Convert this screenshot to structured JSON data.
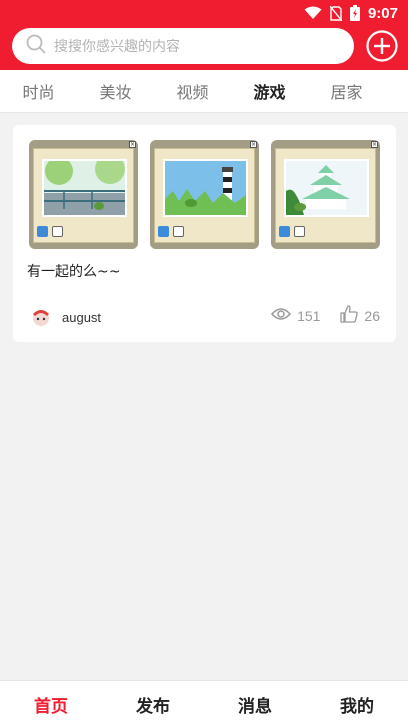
{
  "status_bar": {
    "time": "9:07",
    "icons": [
      "wifi-icon",
      "no-sim-icon",
      "battery-charging-icon"
    ]
  },
  "search": {
    "placeholder": "搜搜你感兴趣的内容",
    "icon": "search-icon"
  },
  "header": {
    "add_icon": "plus-circle-icon"
  },
  "tabs": [
    {
      "label": "时尚",
      "active": false
    },
    {
      "label": "美妆",
      "active": false
    },
    {
      "label": "视频",
      "active": false
    },
    {
      "label": "游戏",
      "active": true
    },
    {
      "label": "居家",
      "active": false
    }
  ],
  "post": {
    "images": [
      "frog-on-railing-thumbnail",
      "frog-lighthouse-thumbnail",
      "frog-castle-thumbnail"
    ],
    "caption": "有一起的么~~",
    "author": "august",
    "views": "151",
    "likes": "26"
  },
  "bottom_nav": [
    {
      "label": "首页",
      "active": true
    },
    {
      "label": "发布",
      "active": false
    },
    {
      "label": "消息",
      "active": false
    },
    {
      "label": "我的",
      "active": false
    }
  ],
  "colors": {
    "brand_red": "#f01c2f",
    "background": "#f2f2f2"
  }
}
